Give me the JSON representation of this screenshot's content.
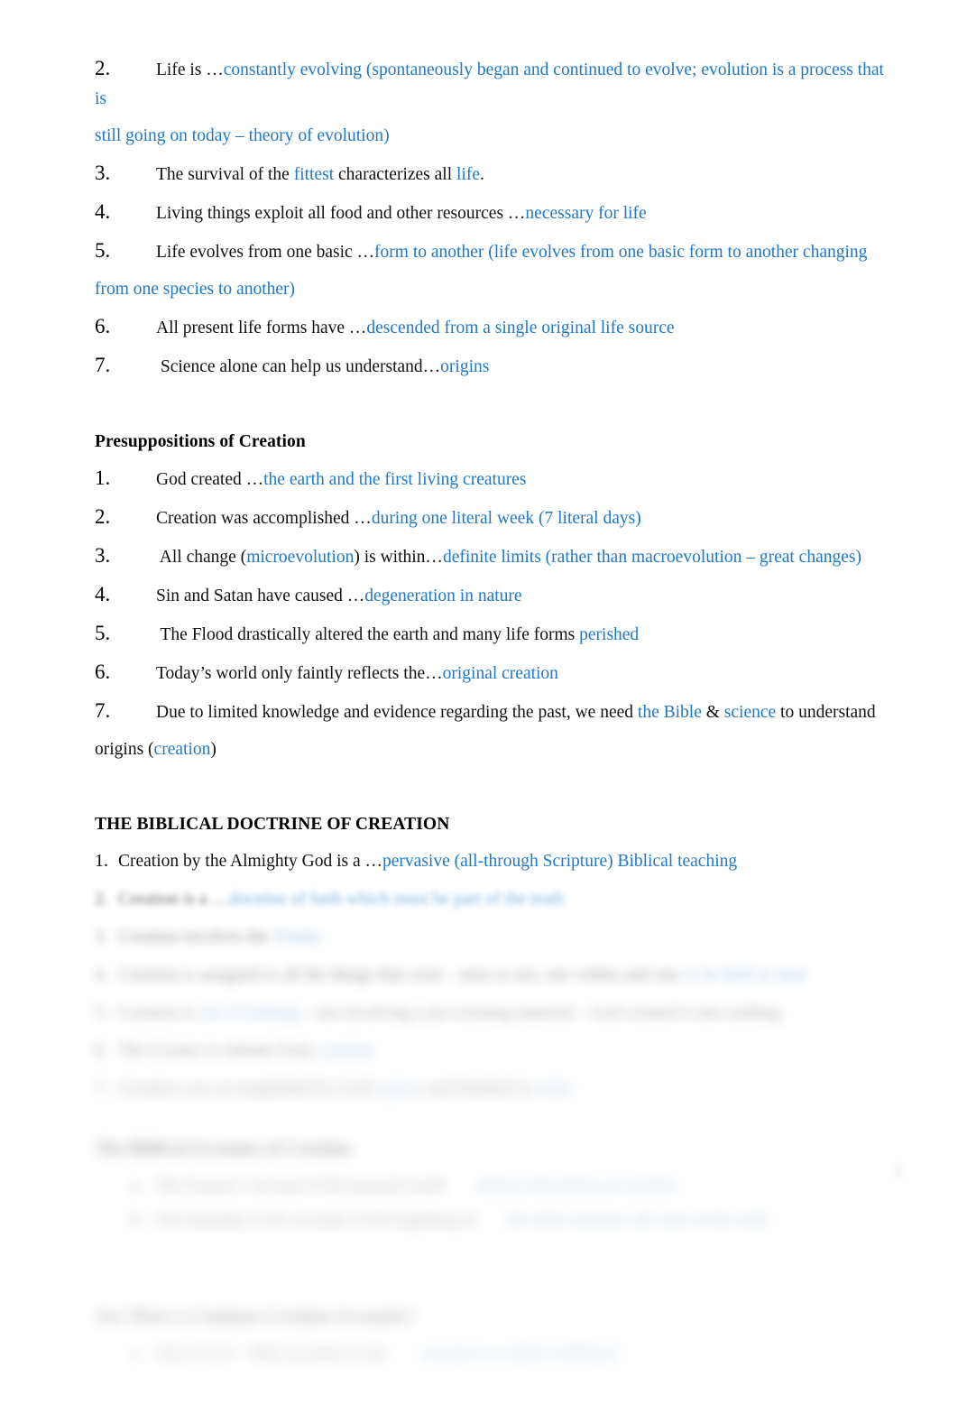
{
  "document": {
    "background_color": "#ffffff",
    "text_color": "#111111",
    "answer_color": "#2079c4",
    "page_number": "2"
  },
  "section_evolution": {
    "items": [
      {
        "number": "2.",
        "prompt": "Life is …",
        "answer": "constantly evolving (spontaneously began and continued to evolve; evolution is a process that is",
        "answer_cont": "still going on today – theory of evolution)"
      },
      {
        "number": "3.",
        "prompt": "The survival of the ",
        "answer": "fittest",
        "prompt_2": " characterizes all ",
        "answer_2": "life",
        "prompt_3": "."
      },
      {
        "number": "4.",
        "prompt": "Living things exploit all food and other resources …",
        "answer": "necessary for life"
      },
      {
        "number": "5.",
        "prompt": "Life evolves from one basic …",
        "answer": "form to another (life evolves from one basic form to another changing",
        "answer_cont": "from one species to another)"
      },
      {
        "number": "6.",
        "prompt": "All present life forms have …",
        "answer": "descended from a single original life source"
      },
      {
        "number": "7.",
        "prompt": " Science alone can help us understand…",
        "answer": "origins"
      }
    ]
  },
  "section_presuppositions": {
    "heading": "Presuppositions of Creation",
    "items": [
      {
        "number": "1.",
        "prompt": "God created …",
        "answer": "the earth and the first living creatures"
      },
      {
        "number": "2.",
        "prompt": "Creation was accomplished …",
        "answer": "during one literal week (7 literal days)"
      },
      {
        "number": "3.",
        "prompt": " All change (",
        "answer": "microevolution",
        "prompt_2": ") is within…",
        "answer_2": "definite limits (rather than macroevolution – great changes)"
      },
      {
        "number": "4.",
        "prompt": "Sin and Satan have caused …",
        "answer": "degeneration in nature"
      },
      {
        "number": "5.",
        "prompt": " The Flood drastically altered the earth and many life forms ",
        "answer": "perished"
      },
      {
        "number": "6.",
        "prompt": "Today’s world only faintly reflects the…",
        "answer": "original creation"
      },
      {
        "number": "7.",
        "prompt": "Due to limited knowledge and evidence regarding the past, we need ",
        "answer": "the Bible",
        "prompt_2": " & ",
        "answer_2": "science",
        "prompt_3": " to understand",
        "prompt_cont": "origins (",
        "answer_cont": "creation",
        "prompt_cont_2": ")"
      }
    ]
  },
  "section_doctrine": {
    "heading": "THE BIBLICAL DOCTRINE OF CREATION",
    "items": [
      {
        "number": "1.",
        "prompt": "Creation by the Almighty God is a …",
        "answer": "pervasive (all-through Scripture) Biblical teaching",
        "blur": "none"
      },
      {
        "number": "2.",
        "prompt": "Creation is a …",
        "answer": "doctrine of faith which must be part of the truth",
        "blur": "b2"
      },
      {
        "number": "3.",
        "prompt": "Creation involves the ",
        "answer": "Trinity",
        "blur": "b4"
      },
      {
        "number": "4.",
        "prompt": "Creation is assigned to all the things that exist – seen or not, one within and one ",
        "answer": "to be held in time",
        "blur": "b5"
      },
      {
        "number": "5.",
        "prompt": "Creation is ",
        "answer": "out of nothing",
        "prompt_2": " – not involving a pre-existing material – God created it into nothing",
        "blur": "b6"
      },
      {
        "number": "6.",
        "prompt": "The Creator is infinite from ",
        "answer": "creation",
        "blur": "b6"
      },
      {
        "number": "7.",
        "prompt": "Creation was accomplished by God’s ",
        "answer": "glory",
        "prompt_2": " and finished in ",
        "answer_2": "order",
        "blur": "b7"
      }
    ]
  },
  "section_biblical_accounts": {
    "heading": "The Biblical Accounts of Creation",
    "blur": "b7",
    "items": [
      {
        "marker": "a.",
        "prompt": "The Genesis 1 account of the material world",
        "answer": "which is the climax of creation",
        "blur": "b7"
      },
      {
        "marker": "b.",
        "prompt": "Our humanity in the accounts of the beginning of",
        "answer": "the entire universe, the seen on the earth",
        "blur": "b7"
      }
    ]
  },
  "section_question": {
    "heading": "Are There a Common Creation Accounts?",
    "blur": "b8",
    "items": [
      {
        "marker": "a.",
        "prompt": "Gen 1:1-2:3 – Who accounts to one ",
        "answer": "account as a whole in Biblical",
        "blur": "b8"
      }
    ]
  }
}
